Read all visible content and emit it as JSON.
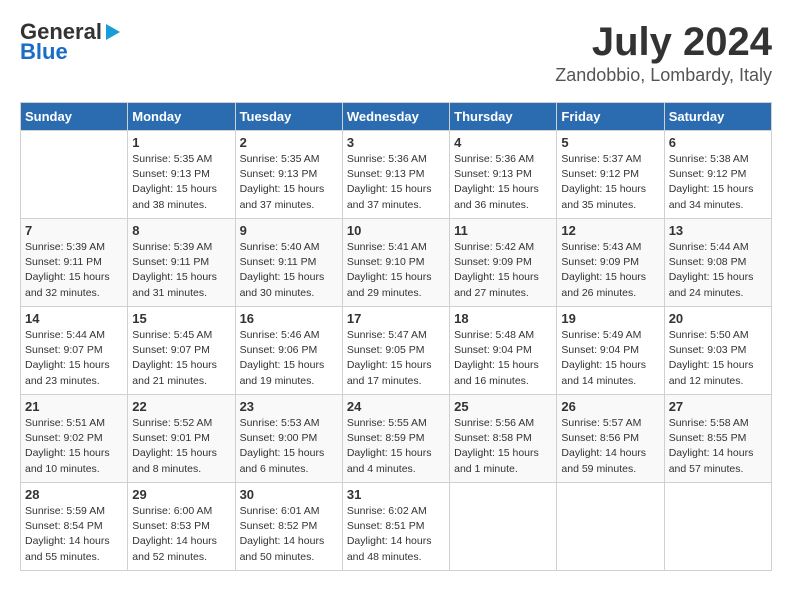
{
  "header": {
    "logo_general": "General",
    "logo_blue": "Blue",
    "title": "July 2024",
    "subtitle": "Zandobbio, Lombardy, Italy"
  },
  "weekdays": [
    "Sunday",
    "Monday",
    "Tuesday",
    "Wednesday",
    "Thursday",
    "Friday",
    "Saturday"
  ],
  "weeks": [
    [
      {
        "day": "",
        "info": ""
      },
      {
        "day": "1",
        "info": "Sunrise: 5:35 AM\nSunset: 9:13 PM\nDaylight: 15 hours\nand 38 minutes."
      },
      {
        "day": "2",
        "info": "Sunrise: 5:35 AM\nSunset: 9:13 PM\nDaylight: 15 hours\nand 37 minutes."
      },
      {
        "day": "3",
        "info": "Sunrise: 5:36 AM\nSunset: 9:13 PM\nDaylight: 15 hours\nand 37 minutes."
      },
      {
        "day": "4",
        "info": "Sunrise: 5:36 AM\nSunset: 9:13 PM\nDaylight: 15 hours\nand 36 minutes."
      },
      {
        "day": "5",
        "info": "Sunrise: 5:37 AM\nSunset: 9:12 PM\nDaylight: 15 hours\nand 35 minutes."
      },
      {
        "day": "6",
        "info": "Sunrise: 5:38 AM\nSunset: 9:12 PM\nDaylight: 15 hours\nand 34 minutes."
      }
    ],
    [
      {
        "day": "7",
        "info": "Sunrise: 5:39 AM\nSunset: 9:11 PM\nDaylight: 15 hours\nand 32 minutes."
      },
      {
        "day": "8",
        "info": "Sunrise: 5:39 AM\nSunset: 9:11 PM\nDaylight: 15 hours\nand 31 minutes."
      },
      {
        "day": "9",
        "info": "Sunrise: 5:40 AM\nSunset: 9:11 PM\nDaylight: 15 hours\nand 30 minutes."
      },
      {
        "day": "10",
        "info": "Sunrise: 5:41 AM\nSunset: 9:10 PM\nDaylight: 15 hours\nand 29 minutes."
      },
      {
        "day": "11",
        "info": "Sunrise: 5:42 AM\nSunset: 9:09 PM\nDaylight: 15 hours\nand 27 minutes."
      },
      {
        "day": "12",
        "info": "Sunrise: 5:43 AM\nSunset: 9:09 PM\nDaylight: 15 hours\nand 26 minutes."
      },
      {
        "day": "13",
        "info": "Sunrise: 5:44 AM\nSunset: 9:08 PM\nDaylight: 15 hours\nand 24 minutes."
      }
    ],
    [
      {
        "day": "14",
        "info": "Sunrise: 5:44 AM\nSunset: 9:07 PM\nDaylight: 15 hours\nand 23 minutes."
      },
      {
        "day": "15",
        "info": "Sunrise: 5:45 AM\nSunset: 9:07 PM\nDaylight: 15 hours\nand 21 minutes."
      },
      {
        "day": "16",
        "info": "Sunrise: 5:46 AM\nSunset: 9:06 PM\nDaylight: 15 hours\nand 19 minutes."
      },
      {
        "day": "17",
        "info": "Sunrise: 5:47 AM\nSunset: 9:05 PM\nDaylight: 15 hours\nand 17 minutes."
      },
      {
        "day": "18",
        "info": "Sunrise: 5:48 AM\nSunset: 9:04 PM\nDaylight: 15 hours\nand 16 minutes."
      },
      {
        "day": "19",
        "info": "Sunrise: 5:49 AM\nSunset: 9:04 PM\nDaylight: 15 hours\nand 14 minutes."
      },
      {
        "day": "20",
        "info": "Sunrise: 5:50 AM\nSunset: 9:03 PM\nDaylight: 15 hours\nand 12 minutes."
      }
    ],
    [
      {
        "day": "21",
        "info": "Sunrise: 5:51 AM\nSunset: 9:02 PM\nDaylight: 15 hours\nand 10 minutes."
      },
      {
        "day": "22",
        "info": "Sunrise: 5:52 AM\nSunset: 9:01 PM\nDaylight: 15 hours\nand 8 minutes."
      },
      {
        "day": "23",
        "info": "Sunrise: 5:53 AM\nSunset: 9:00 PM\nDaylight: 15 hours\nand 6 minutes."
      },
      {
        "day": "24",
        "info": "Sunrise: 5:55 AM\nSunset: 8:59 PM\nDaylight: 15 hours\nand 4 minutes."
      },
      {
        "day": "25",
        "info": "Sunrise: 5:56 AM\nSunset: 8:58 PM\nDaylight: 15 hours\nand 1 minute."
      },
      {
        "day": "26",
        "info": "Sunrise: 5:57 AM\nSunset: 8:56 PM\nDaylight: 14 hours\nand 59 minutes."
      },
      {
        "day": "27",
        "info": "Sunrise: 5:58 AM\nSunset: 8:55 PM\nDaylight: 14 hours\nand 57 minutes."
      }
    ],
    [
      {
        "day": "28",
        "info": "Sunrise: 5:59 AM\nSunset: 8:54 PM\nDaylight: 14 hours\nand 55 minutes."
      },
      {
        "day": "29",
        "info": "Sunrise: 6:00 AM\nSunset: 8:53 PM\nDaylight: 14 hours\nand 52 minutes."
      },
      {
        "day": "30",
        "info": "Sunrise: 6:01 AM\nSunset: 8:52 PM\nDaylight: 14 hours\nand 50 minutes."
      },
      {
        "day": "31",
        "info": "Sunrise: 6:02 AM\nSunset: 8:51 PM\nDaylight: 14 hours\nand 48 minutes."
      },
      {
        "day": "",
        "info": ""
      },
      {
        "day": "",
        "info": ""
      },
      {
        "day": "",
        "info": ""
      }
    ]
  ]
}
